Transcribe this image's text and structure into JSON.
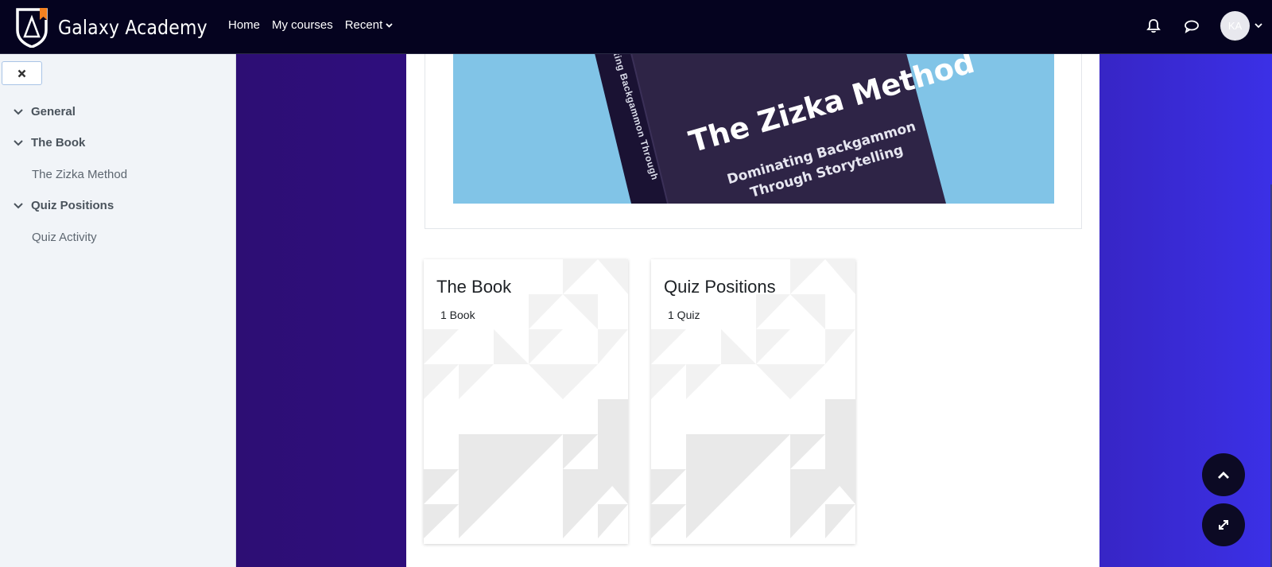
{
  "brand": {
    "name": "Galaxy Academy",
    "logo_icon": "shield-logo-icon",
    "accent": "#f58220"
  },
  "nav": {
    "links": [
      {
        "label": "Home"
      },
      {
        "label": "My courses"
      },
      {
        "label": "Recent"
      }
    ],
    "notifications_icon": "bell-icon",
    "messages_icon": "chat-bubble-icon",
    "user_initials": "KA"
  },
  "drawer": {
    "close_icon": "close-icon",
    "sections": [
      {
        "label": "General",
        "items": []
      },
      {
        "label": "The Book",
        "items": [
          {
            "label": "The Zizka Method"
          }
        ]
      },
      {
        "label": "Quiz Positions",
        "items": [
          {
            "label": "Quiz Activity"
          }
        ]
      }
    ]
  },
  "hero": {
    "title": "The Zizka Method",
    "subtitle_line1": "Dominating Backgammon",
    "subtitle_line2": "Through Storytelling",
    "spine_text": "ating Backgammon Through"
  },
  "cards": [
    {
      "title": "The Book",
      "count": "1 Book"
    },
    {
      "title": "Quiz Positions",
      "count": "1 Quiz"
    }
  ],
  "fabs": {
    "scroll_top_icon": "chevron-up-icon",
    "fullscreen_icon": "expand-icon"
  },
  "colors": {
    "navbar": "#05031f",
    "drawer_bg": "#f1f4f8",
    "hero_sky": "#81c4e7",
    "book_cover": "#2e2446",
    "gradient_start": "#2d0e74",
    "gradient_end": "#3b30e6"
  }
}
